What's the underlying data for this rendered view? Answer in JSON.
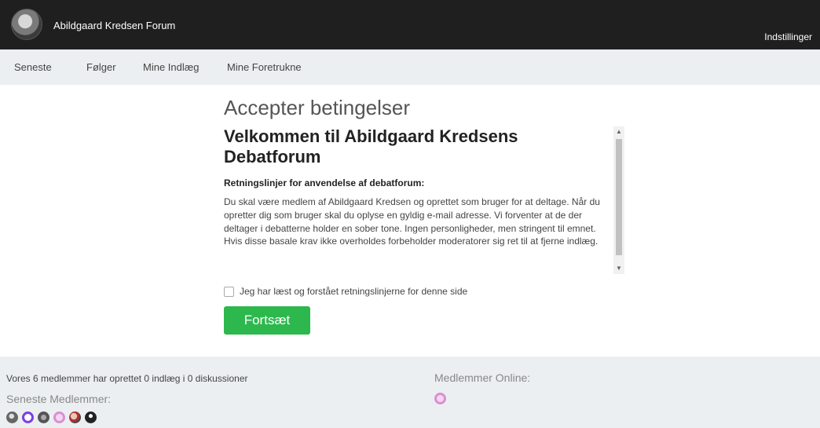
{
  "header": {
    "site_title": "Abildgaard Kredsen Forum",
    "settings_label": "Indstillinger"
  },
  "nav": {
    "items": [
      "Seneste",
      "Følger",
      "Mine Indlæg",
      "Mine Foretrukne"
    ]
  },
  "main": {
    "page_title": "Accepter betingelser",
    "terms": {
      "heading": "Velkommen til Abildgaard Kredsens Debatforum",
      "subheading": "Retningslinjer for anvendelse af debatforum:",
      "body": "Du skal være medlem af Abildgaard Kredsen og oprettet som bruger for at deltage. Når du opretter dig som bruger skal du oplyse en gyldig e-mail adresse. Vi forventer at de der deltager i debatterne holder en sober tone. Ingen personligheder, men stringent til emnet. Hvis disse basale krav ikke overholdes forbeholder moderatorer sig ret til at fjerne indlæg."
    },
    "agree_label": "Jeg har læst og forstået retningslinjerne for denne side",
    "continue_label": "Fortsæt"
  },
  "footer": {
    "stats": "Vores 6 medlemmer har oprettet 0 indlæg i 0 diskussioner",
    "recent_members_title": "Seneste Medlemmer:",
    "online_title": "Medlemmer Online:"
  },
  "colors": {
    "topbar": "#1f1f1f",
    "navbar": "#eceff1",
    "button": "#2db84d"
  }
}
